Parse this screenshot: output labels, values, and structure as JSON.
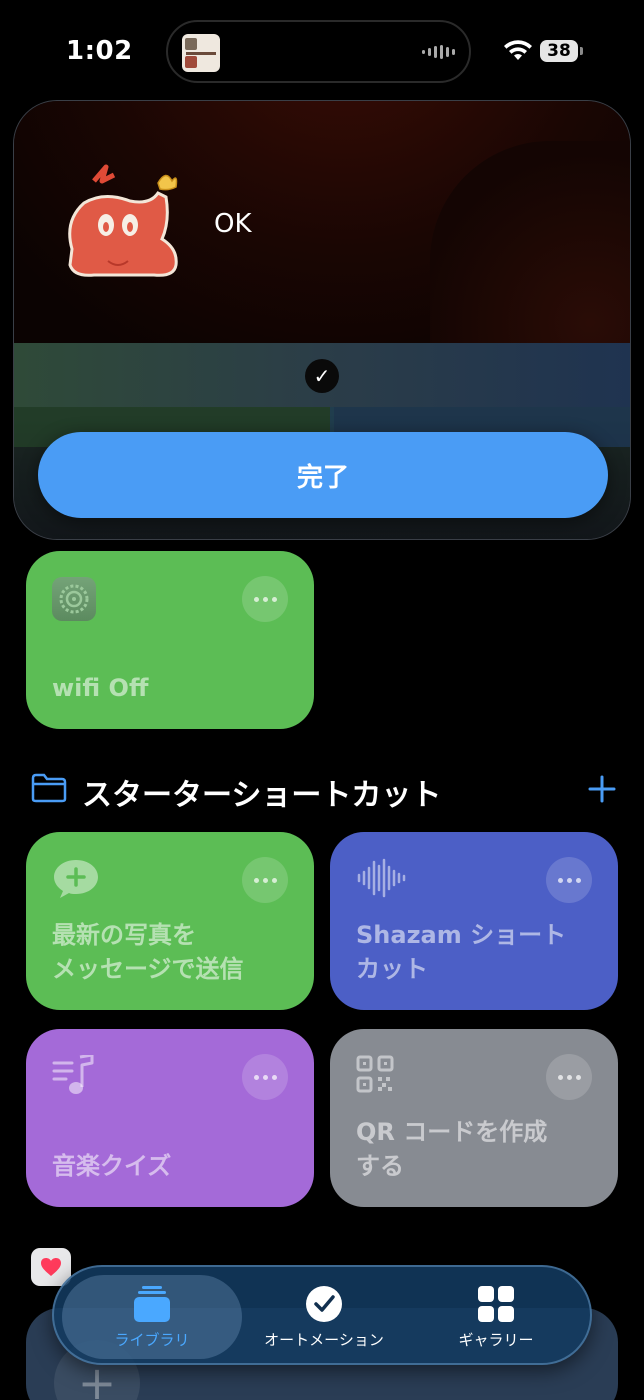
{
  "status_bar": {
    "time": "1:02",
    "battery": "38",
    "now_playing_art": "STUDY MUSIC COFFEE"
  },
  "result_sheet": {
    "message": "OK",
    "done_label": "完了",
    "check_icon": "checkmark-icon"
  },
  "shortcuts_top": [
    {
      "label": "wifi Off",
      "color": "#5cbd55",
      "icon": "settings-icon"
    }
  ],
  "folder": {
    "title": "スターターショートカット",
    "icon": "folder-icon"
  },
  "starter_shortcuts": [
    {
      "label": "最新の写真を\nメッセージで送信",
      "color": "#5cbd55",
      "icon": "message-plus-icon"
    },
    {
      "label": "Shazam ショート\nカット",
      "color": "#4c5fc6",
      "icon": "waveform-icon"
    },
    {
      "label": "音楽クイズ",
      "color": "#a46ad8",
      "icon": "music-list-icon"
    },
    {
      "label": "QR コードを作成\nする",
      "color": "#878b92",
      "icon": "qr-code-icon"
    }
  ],
  "tabs": [
    {
      "label": "ライブラリ",
      "icon": "library-icon",
      "active": true
    },
    {
      "label": "オートメーション",
      "icon": "automation-icon",
      "active": false
    },
    {
      "label": "ギャラリー",
      "icon": "gallery-icon",
      "active": false
    }
  ],
  "colors": {
    "accent": "#4a9cf5",
    "tab_active": "#4aa8ff"
  }
}
